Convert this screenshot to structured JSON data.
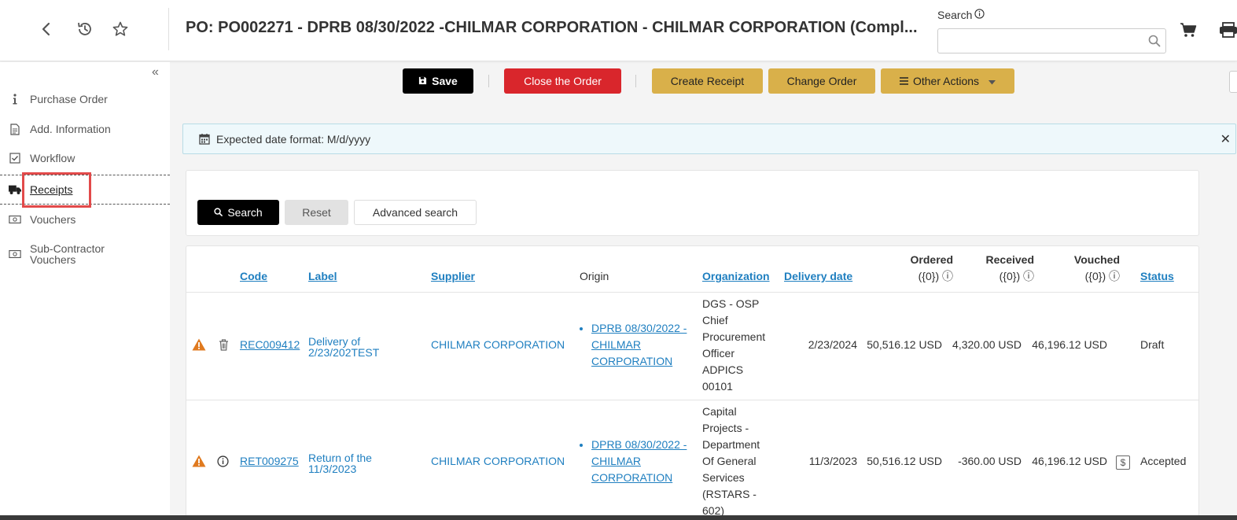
{
  "header": {
    "title": "PO: PO002271 - DPRB 08/30/2022 -CHILMAR CORPORATION - CHILMAR CORPORATION (Compl...",
    "search_label": "Search",
    "search_value": ""
  },
  "sidebar": {
    "items": [
      {
        "label": "Purchase Order"
      },
      {
        "label": "Add. Information"
      },
      {
        "label": "Workflow"
      },
      {
        "label": "Receipts"
      },
      {
        "label": "Vouchers"
      },
      {
        "label": "Sub-Contractor Vouchers"
      }
    ]
  },
  "toolbar": {
    "save": "Save",
    "close_order": "Close the Order",
    "create_receipt": "Create Receipt",
    "change_order": "Change Order",
    "other_actions": "Other Actions"
  },
  "banner": {
    "text": "Expected date format: M/d/yyyy"
  },
  "search_panel": {
    "search": "Search",
    "reset": "Reset",
    "advanced": "Advanced search"
  },
  "table": {
    "columns": {
      "code": "Code",
      "label": "Label",
      "supplier": "Supplier",
      "origin": "Origin",
      "organization": "Organization",
      "delivery_date": "Delivery date",
      "ordered": "Ordered",
      "received": "Received",
      "vouched": "Vouched",
      "unit": "({0})",
      "status": "Status"
    },
    "rows": [
      {
        "code": "REC009412",
        "label": "Delivery of 2/23/202TEST",
        "supplier": "CHILMAR CORPORATION",
        "origin": "DPRB 08/30/2022 - CHILMAR CORPORATION",
        "organization": "DGS - OSP Chief Procurement Officer ADPICS 00101",
        "delivery_date": "2/23/2024",
        "ordered": "50,516.12 USD",
        "received": "4,320.00 USD",
        "vouched": "46,196.12 USD",
        "status": "Draft"
      },
      {
        "code": "RET009275",
        "label": "Return of the 11/3/2023",
        "supplier": "CHILMAR CORPORATION",
        "origin": "DPRB 08/30/2022 - CHILMAR CORPORATION",
        "organization": "Capital Projects - Department Of General Services (RSTARS - 602)",
        "delivery_date": "11/3/2023",
        "ordered": "50,516.12 USD",
        "received": "-360.00 USD",
        "vouched": "46,196.12 USD",
        "status": "Accepted"
      }
    ]
  },
  "colors": {
    "accent_link": "#1f7fc0",
    "danger": "#d9262c",
    "gold": "#d9b04a",
    "highlight_box": "#e24a4a",
    "warning": "#e07a1f"
  }
}
